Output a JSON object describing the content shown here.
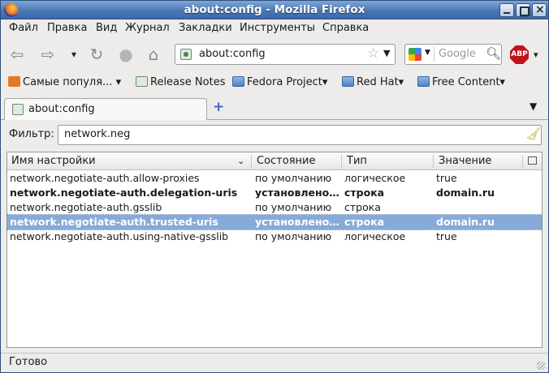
{
  "window": {
    "title": "about:config - Mozilla Firefox"
  },
  "menubar": {
    "items": [
      "Файл",
      "Правка",
      "Вид",
      "Журнал",
      "Закладки",
      "Инструменты",
      "Справка"
    ]
  },
  "navbar": {
    "url": "about:config",
    "search_placeholder": "Google",
    "abp_label": "ABP"
  },
  "bookmarks": {
    "items": [
      {
        "label": "Самые популя...",
        "icon": "rss-icon",
        "dropdown": true
      },
      {
        "label": "Release Notes",
        "icon": "page-icon",
        "dropdown": false
      },
      {
        "label": "Fedora Project",
        "icon": "folder-icon",
        "dropdown": true
      },
      {
        "label": "Red Hat",
        "icon": "folder-icon",
        "dropdown": true
      },
      {
        "label": "Free Content",
        "icon": "folder-icon",
        "dropdown": true
      }
    ]
  },
  "tabs": [
    {
      "label": "about:config",
      "active": true
    }
  ],
  "filter": {
    "label": "Фильтр:",
    "value": "network.neg"
  },
  "table": {
    "columns": [
      "Имя настройки",
      "Состояние",
      "Тип",
      "Значение"
    ],
    "rows": [
      {
        "name": "network.negotiate-auth.allow-proxies",
        "state": "по умолчанию",
        "type": "логическое",
        "value": "true",
        "bold": false,
        "selected": false
      },
      {
        "name": "network.negotiate-auth.delegation-uris",
        "state": "установлено пользователем",
        "type": "строка",
        "value": "domain.ru",
        "bold": true,
        "selected": false
      },
      {
        "name": "network.negotiate-auth.gsslib",
        "state": "по умолчанию",
        "type": "строка",
        "value": "",
        "bold": false,
        "selected": false
      },
      {
        "name": "network.negotiate-auth.trusted-uris",
        "state": "установлено пользователем",
        "type": "строка",
        "value": "domain.ru",
        "bold": true,
        "selected": true
      },
      {
        "name": "network.negotiate-auth.using-native-gsslib",
        "state": "по умолчанию",
        "type": "логическое",
        "value": "true",
        "bold": false,
        "selected": false
      }
    ]
  },
  "statusbar": {
    "text": "Готово"
  },
  "colors": {
    "selection": "#86abd9",
    "titlebar": "#4a78b4",
    "abp": "#c0141a"
  }
}
